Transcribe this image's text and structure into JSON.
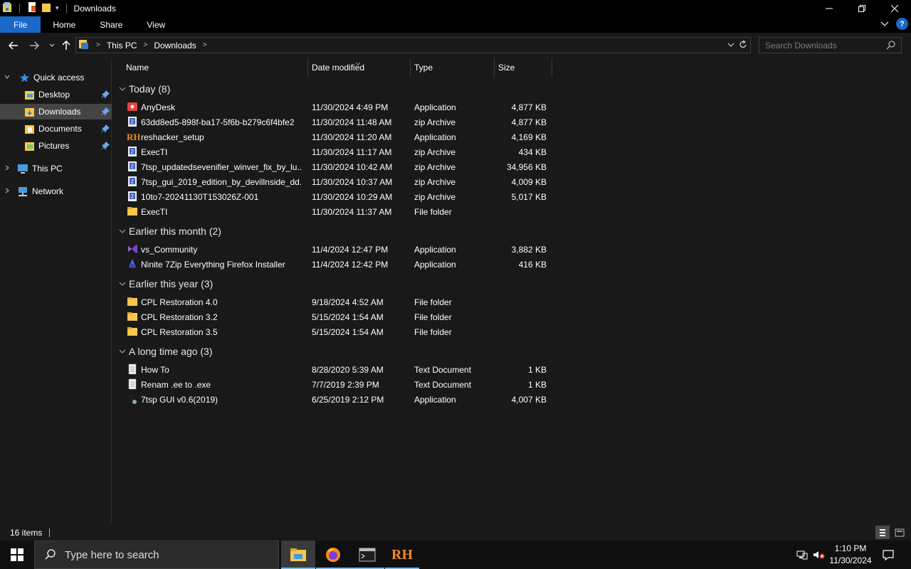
{
  "window": {
    "title": "Downloads"
  },
  "ribbon": {
    "tabs": [
      "File",
      "Home",
      "Share",
      "View"
    ]
  },
  "address": {
    "crumbs": [
      "This PC",
      "Downloads"
    ],
    "search_placeholder": "Search Downloads"
  },
  "nav": {
    "quick_access": "Quick access",
    "items": [
      "Desktop",
      "Downloads",
      "Documents",
      "Pictures"
    ],
    "this_pc": "This PC",
    "network": "Network"
  },
  "columns": {
    "name": "Name",
    "date": "Date modified",
    "type": "Type",
    "size": "Size"
  },
  "groups": [
    {
      "title": "Today (8)",
      "files": [
        {
          "name": "AnyDesk",
          "date": "11/30/2024 4:49 PM",
          "type": "Application",
          "size": "4,877 KB",
          "icon": "anydesk-icon"
        },
        {
          "name": "63dd8ed5-898f-ba17-5f6b-b279c6f4bfe2",
          "date": "11/30/2024 11:48 AM",
          "type": "zip Archive",
          "size": "4,877 KB",
          "icon": "zip-icon"
        },
        {
          "name": "reshacker_setup",
          "date": "11/30/2024 11:20 AM",
          "type": "Application",
          "size": "4,169 KB",
          "icon": "reshacker-icon"
        },
        {
          "name": "ExecTI",
          "date": "11/30/2024 11:17 AM",
          "type": "zip Archive",
          "size": "434 KB",
          "icon": "zip-icon"
        },
        {
          "name": "7tsp_updatedsevenifier_winver_fix_by_lu...",
          "date": "11/30/2024 10:42 AM",
          "type": "zip Archive",
          "size": "34,956 KB",
          "icon": "zip-icon"
        },
        {
          "name": "7tsp_gui_2019_edition_by_devillnside_dd...",
          "date": "11/30/2024 10:37 AM",
          "type": "zip Archive",
          "size": "4,009 KB",
          "icon": "zip-icon"
        },
        {
          "name": "10to7-20241130T153026Z-001",
          "date": "11/30/2024 10:29 AM",
          "type": "zip Archive",
          "size": "5,017 KB",
          "icon": "zip-icon"
        },
        {
          "name": "ExecTI",
          "date": "11/30/2024 11:37 AM",
          "type": "File folder",
          "size": "",
          "icon": "folder-icon"
        }
      ]
    },
    {
      "title": "Earlier this month (2)",
      "files": [
        {
          "name": "vs_Community",
          "date": "11/4/2024 12:47 PM",
          "type": "Application",
          "size": "3,882 KB",
          "icon": "visual-studio-icon"
        },
        {
          "name": "Ninite 7Zip Everything Firefox Installer",
          "date": "11/4/2024 12:42 PM",
          "type": "Application",
          "size": "416 KB",
          "icon": "ninite-icon"
        }
      ]
    },
    {
      "title": "Earlier this year (3)",
      "files": [
        {
          "name": "CPL Restoration 4.0",
          "date": "9/18/2024 4:52 AM",
          "type": "File folder",
          "size": "",
          "icon": "folder-icon"
        },
        {
          "name": "CPL Restoration 3.2",
          "date": "5/15/2024 1:54 AM",
          "type": "File folder",
          "size": "",
          "icon": "folder-icon"
        },
        {
          "name": "CPL Restoration 3.5",
          "date": "5/15/2024 1:54 AM",
          "type": "File folder",
          "size": "",
          "icon": "folder-icon"
        }
      ]
    },
    {
      "title": "A long time ago (3)",
      "files": [
        {
          "name": "How To",
          "date": "8/28/2020 5:39 AM",
          "type": "Text Document",
          "size": "1 KB",
          "icon": "text-document-icon"
        },
        {
          "name": "Renam .ee to .exe",
          "date": "7/7/2019 2:39 PM",
          "type": "Text Document",
          "size": "1 KB",
          "icon": "text-document-icon"
        },
        {
          "name": "7tsp GUI v0.6(2019)",
          "date": "6/25/2019 2:12 PM",
          "type": "Application",
          "size": "4,007 KB",
          "icon": "7tsp-icon"
        }
      ]
    }
  ],
  "status": {
    "count": "16 items"
  },
  "taskbar": {
    "search_placeholder": "Type here to search",
    "time": "1:10 PM",
    "date": "11/30/2024"
  },
  "colors": {
    "file_tab": "#1a68c8",
    "selection": "#444444",
    "folder": "#f5c84b",
    "taskbar_accent": "#76b9ed"
  }
}
